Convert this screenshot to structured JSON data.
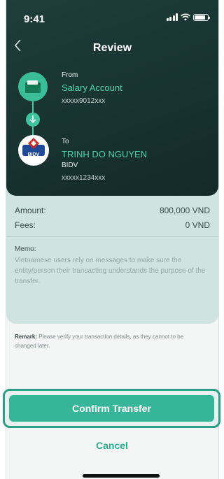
{
  "status_bar": {
    "time": "9:41"
  },
  "header": {
    "title": "Review"
  },
  "from": {
    "label": "From",
    "account_name": "Salary Account",
    "account_number": "xxxxx9012xxx"
  },
  "to": {
    "label": "To",
    "name": "TRINH DO NGUYEN",
    "bank": "BIDV",
    "account_number": "xxxxx1234xxx",
    "bank_logo_text": "BIDV"
  },
  "details": {
    "amount_label": "Amount:",
    "amount_value": "800,000 VND",
    "fees_label": "Fees:",
    "fees_value": "0 VND",
    "memo_label": "Memo:",
    "memo_text": "Vietnamese users rely on messages to make sure the entity/person their transacting understands the purpose of the transfer."
  },
  "remark": {
    "label": "Remark:",
    "text": "Please verify your transaction details, as they cannot to be changed later."
  },
  "actions": {
    "confirm_label": "Confirm Transfer",
    "cancel_label": "Cancel"
  },
  "colors": {
    "header_bg": "#173230",
    "accent": "#36b599",
    "details_bg": "#cfe3e0"
  },
  "icons": [
    "back-arrow",
    "wallet",
    "arrow-down",
    "bidv-logo",
    "signal",
    "wifi",
    "battery"
  ]
}
